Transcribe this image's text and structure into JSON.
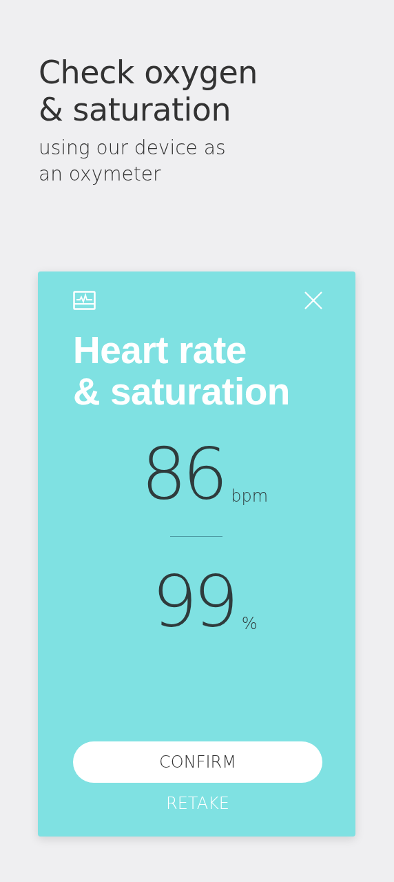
{
  "header": {
    "title_lines": [
      "Check oxygen",
      "& saturation"
    ],
    "subtitle_lines": [
      "using our device as",
      "an oxymeter"
    ]
  },
  "card": {
    "title_lines": [
      "Heart rate",
      "& saturation"
    ],
    "readings": [
      {
        "value": "86",
        "unit": "bpm"
      },
      {
        "value": "99",
        "unit": "%"
      }
    ],
    "buttons": [
      {
        "label": "CONFIRM",
        "kind": "primary"
      },
      {
        "label": "RETAKE",
        "kind": "link"
      }
    ]
  }
}
